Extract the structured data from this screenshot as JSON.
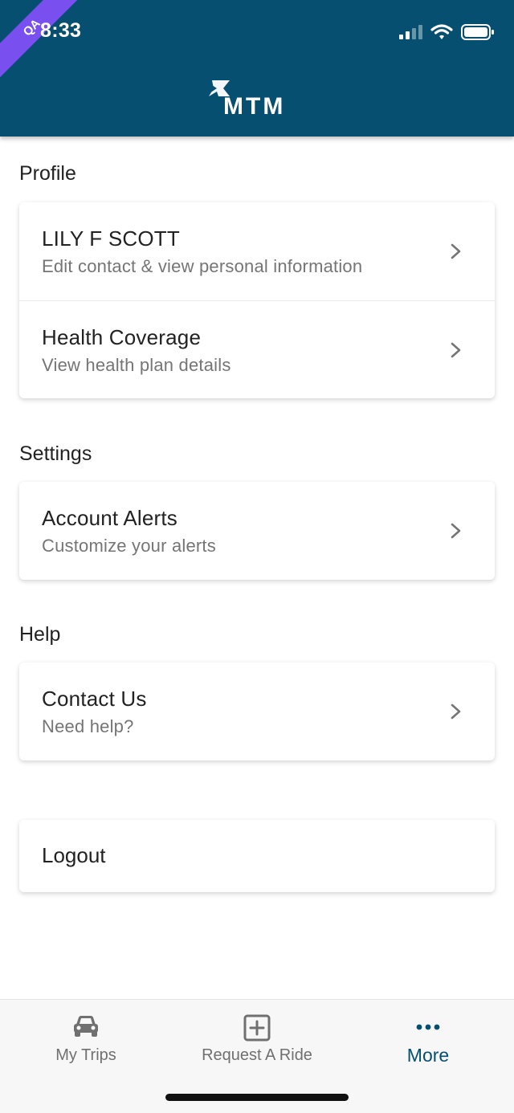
{
  "status_bar": {
    "time": "8:33",
    "qa_badge": "QA"
  },
  "header": {
    "logo_text": "MTM"
  },
  "sections": {
    "profile": {
      "title": "Profile",
      "items": [
        {
          "title": "LILY F SCOTT",
          "subtitle": "Edit contact & view personal information"
        },
        {
          "title": "Health Coverage",
          "subtitle": "View health plan details"
        }
      ]
    },
    "settings": {
      "title": "Settings",
      "items": [
        {
          "title": "Account Alerts",
          "subtitle": "Customize your alerts"
        }
      ]
    },
    "help": {
      "title": "Help",
      "items": [
        {
          "title": "Contact Us",
          "subtitle": "Need help?"
        }
      ]
    }
  },
  "logout": {
    "label": "Logout"
  },
  "bottom_nav": {
    "items": [
      {
        "label": "My Trips",
        "icon": "car-icon"
      },
      {
        "label": "Request A Ride",
        "icon": "plus-square-icon"
      },
      {
        "label": "More",
        "icon": "more-dots-icon",
        "active": true
      }
    ]
  },
  "colors": {
    "brand": "#064f70",
    "qa_ribbon": "#7a4ff0",
    "active_tab": "#064f70",
    "inactive_tab": "#707070"
  }
}
